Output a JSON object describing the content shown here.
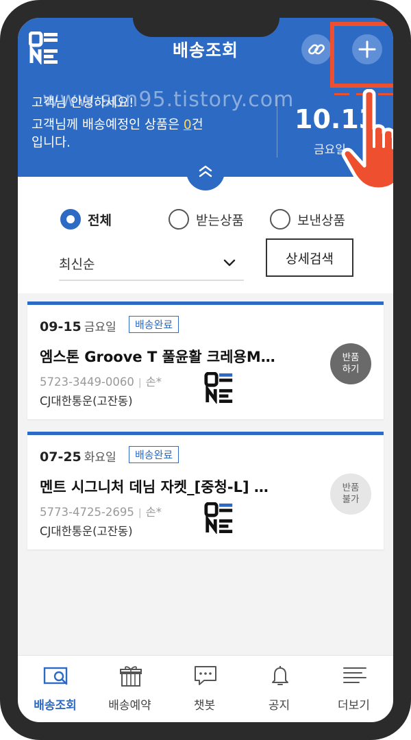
{
  "header": {
    "title": "배송조회",
    "logo_text": "ONE",
    "link_icon": "link-icon",
    "add_icon": "plus-icon"
  },
  "greeting": {
    "line1": "고객님 안녕하세요!",
    "line2_prefix": "고객님께 배송예정인 상품은 ",
    "count": "0",
    "line2_suffix": "건",
    "line3": "입니다.",
    "date": "10.13",
    "day": "금요일"
  },
  "watermark": "www.son95.tistory.com",
  "filters": {
    "options": [
      {
        "label": "전체",
        "selected": true
      },
      {
        "label": "받는상품",
        "selected": false
      },
      {
        "label": "보낸상품",
        "selected": false
      }
    ],
    "sort_value": "최신순",
    "detail_search_label": "상세검색"
  },
  "shipments": [
    {
      "date": "09-15",
      "day": "금요일",
      "status": "배송완료",
      "product": "엠스톤 Groove T 풀윤활 크레용M…",
      "tracking": "5723-3449-0060",
      "recipient": "손*",
      "courier": "CJ대한통운(고잔동)",
      "return_line1": "반품",
      "return_line2": "하기"
    },
    {
      "date": "07-25",
      "day": "화요일",
      "status": "배송완료",
      "product": "멘트 시그니처 데님 자켓_[중청-L] …",
      "tracking": "5773-4725-2695",
      "recipient": "손*",
      "courier": "CJ대한통운(고잔동)",
      "return_line1": "반품",
      "return_line2": "불가"
    }
  ],
  "tabs": [
    {
      "label": "배송조회",
      "active": true,
      "icon": "delivery-search-icon"
    },
    {
      "label": "배송예약",
      "active": false,
      "icon": "gift-icon"
    },
    {
      "label": "챗봇",
      "active": false,
      "icon": "chat-icon"
    },
    {
      "label": "공지",
      "active": false,
      "icon": "bell-icon"
    },
    {
      "label": "더보기",
      "active": false,
      "icon": "menu-icon"
    }
  ],
  "colors": {
    "brand_blue": "#2c6ac3",
    "highlight_red": "#ee4f2f",
    "bezel": "#2b2b2b"
  }
}
